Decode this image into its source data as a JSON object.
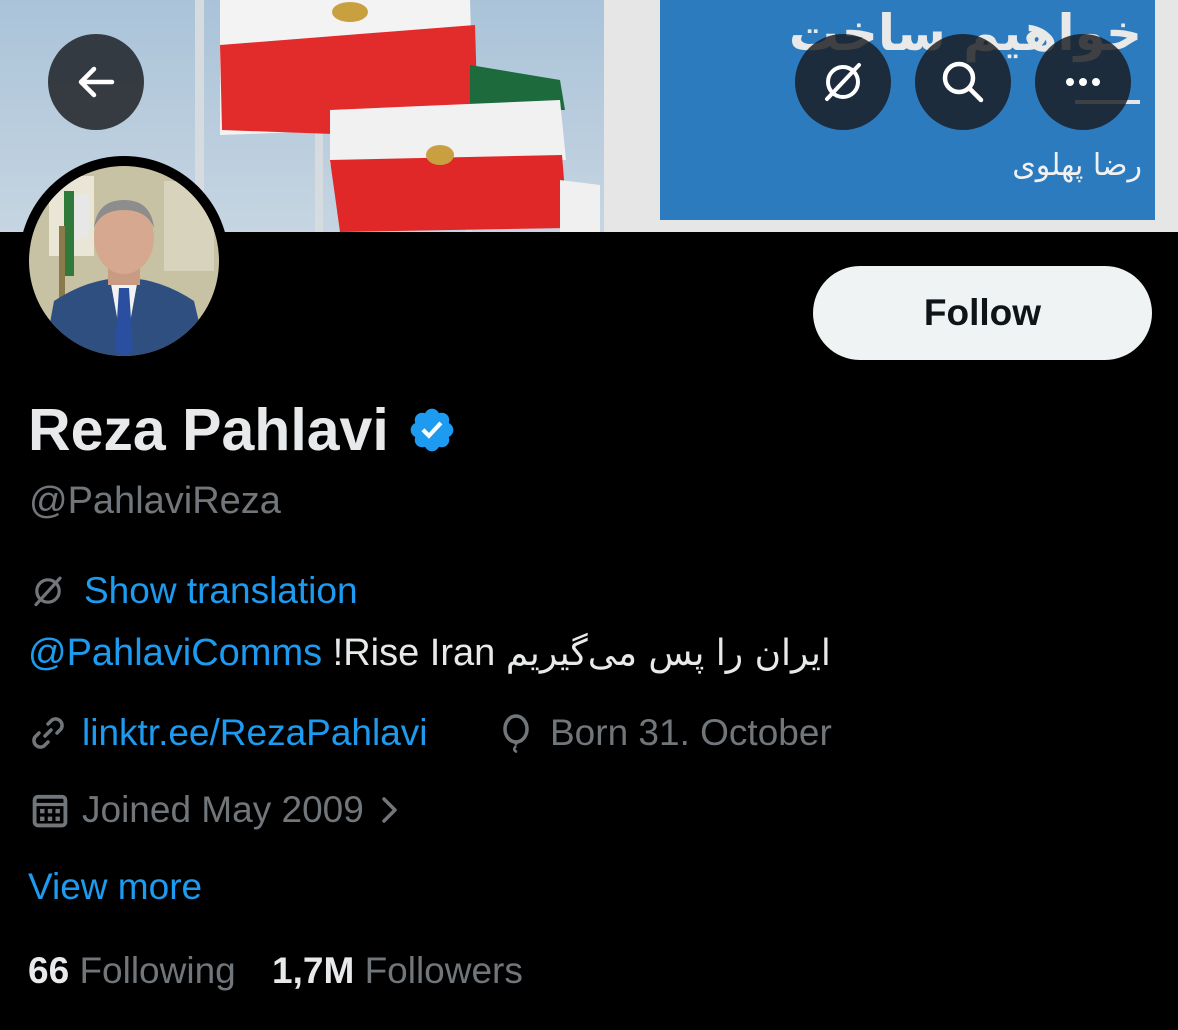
{
  "banner": {
    "headline_fa": "خواهیم ساخت",
    "signature_fa": "رضا پهلوی"
  },
  "top_buttons": {
    "back_icon": "arrow-left-icon",
    "translate_icon": "translate-icon",
    "search_icon": "search-icon",
    "more_icon": "more-icon"
  },
  "profile": {
    "name": "Reza Pahlavi",
    "handle": "@PahlaviReza",
    "verified": true
  },
  "follow_label": "Follow",
  "translation_label": "Show translation",
  "bio": {
    "mention": "@PahlaviComms",
    "text": "!Rise Iran",
    "text_fa": "ایران را پس می‌گیریم"
  },
  "link": "linktr.ee/RezaPahlavi",
  "born": "Born 31. October",
  "joined": "Joined May 2009",
  "view_more": "View more",
  "stats": {
    "following_count": "66",
    "following_label": "Following",
    "followers_count": "1,7M",
    "followers_label": "Followers"
  },
  "colors": {
    "background": "#000000",
    "accent": "#1d9bf0",
    "muted": "#71767b",
    "text": "#e7e9ea",
    "button_bg": "#eff3f4"
  }
}
